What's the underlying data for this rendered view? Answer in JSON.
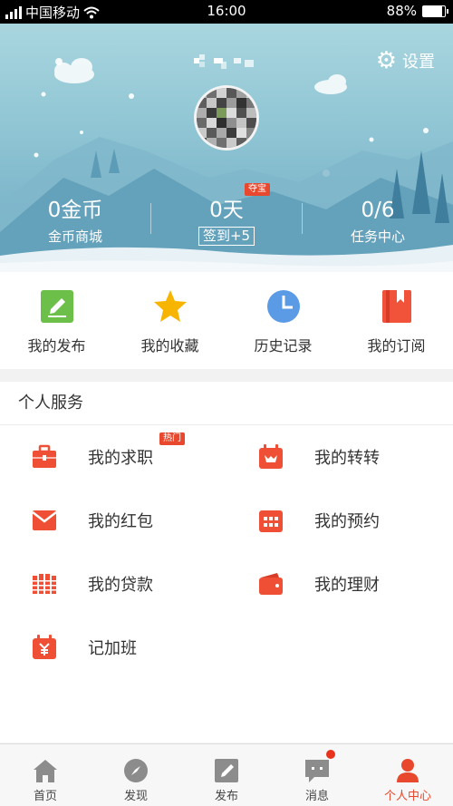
{
  "status_bar": {
    "carrier": "中国移动",
    "time": "16:00",
    "battery": "88%",
    "battery_level": 0.88
  },
  "header": {
    "settings_label": "设置",
    "settings_icon": "gear-icon"
  },
  "stats": [
    {
      "value": "0金币",
      "label": "金币商城"
    },
    {
      "value": "0天",
      "label": "签到+5",
      "badge": "夺宝"
    },
    {
      "value": "0/6",
      "label": "任务中心"
    }
  ],
  "quick_actions": [
    {
      "label": "我的发布",
      "icon": "edit-icon",
      "color": "#5cb85c"
    },
    {
      "label": "我的收藏",
      "icon": "star-icon",
      "color": "#f5b400"
    },
    {
      "label": "历史记录",
      "icon": "clock-icon",
      "color": "#4a90e2"
    },
    {
      "label": "我的订阅",
      "icon": "bookmark-icon",
      "color": "#e8492e"
    }
  ],
  "services": {
    "title": "个人服务",
    "hot_badge": "热门",
    "items": [
      {
        "label": "我的求职",
        "icon": "briefcase-icon"
      },
      {
        "label": "我的转转",
        "icon": "calendar-fox-icon"
      },
      {
        "label": "我的红包",
        "icon": "envelope-icon"
      },
      {
        "label": "我的预约",
        "icon": "calendar-grid-icon"
      },
      {
        "label": "我的贷款",
        "icon": "money-stack-icon"
      },
      {
        "label": "我的理财",
        "icon": "wallet-icon"
      },
      {
        "label": "记加班",
        "icon": "calendar-yen-icon"
      }
    ],
    "accent": "#e8492e"
  },
  "tabbar": {
    "tabs": [
      {
        "label": "首页",
        "icon": "home-icon"
      },
      {
        "label": "发现",
        "icon": "compass-icon"
      },
      {
        "label": "发布",
        "icon": "pencil-icon"
      },
      {
        "label": "消息",
        "icon": "chat-icon"
      },
      {
        "label": "个人中心",
        "icon": "person-icon"
      }
    ],
    "active_index": 4
  }
}
